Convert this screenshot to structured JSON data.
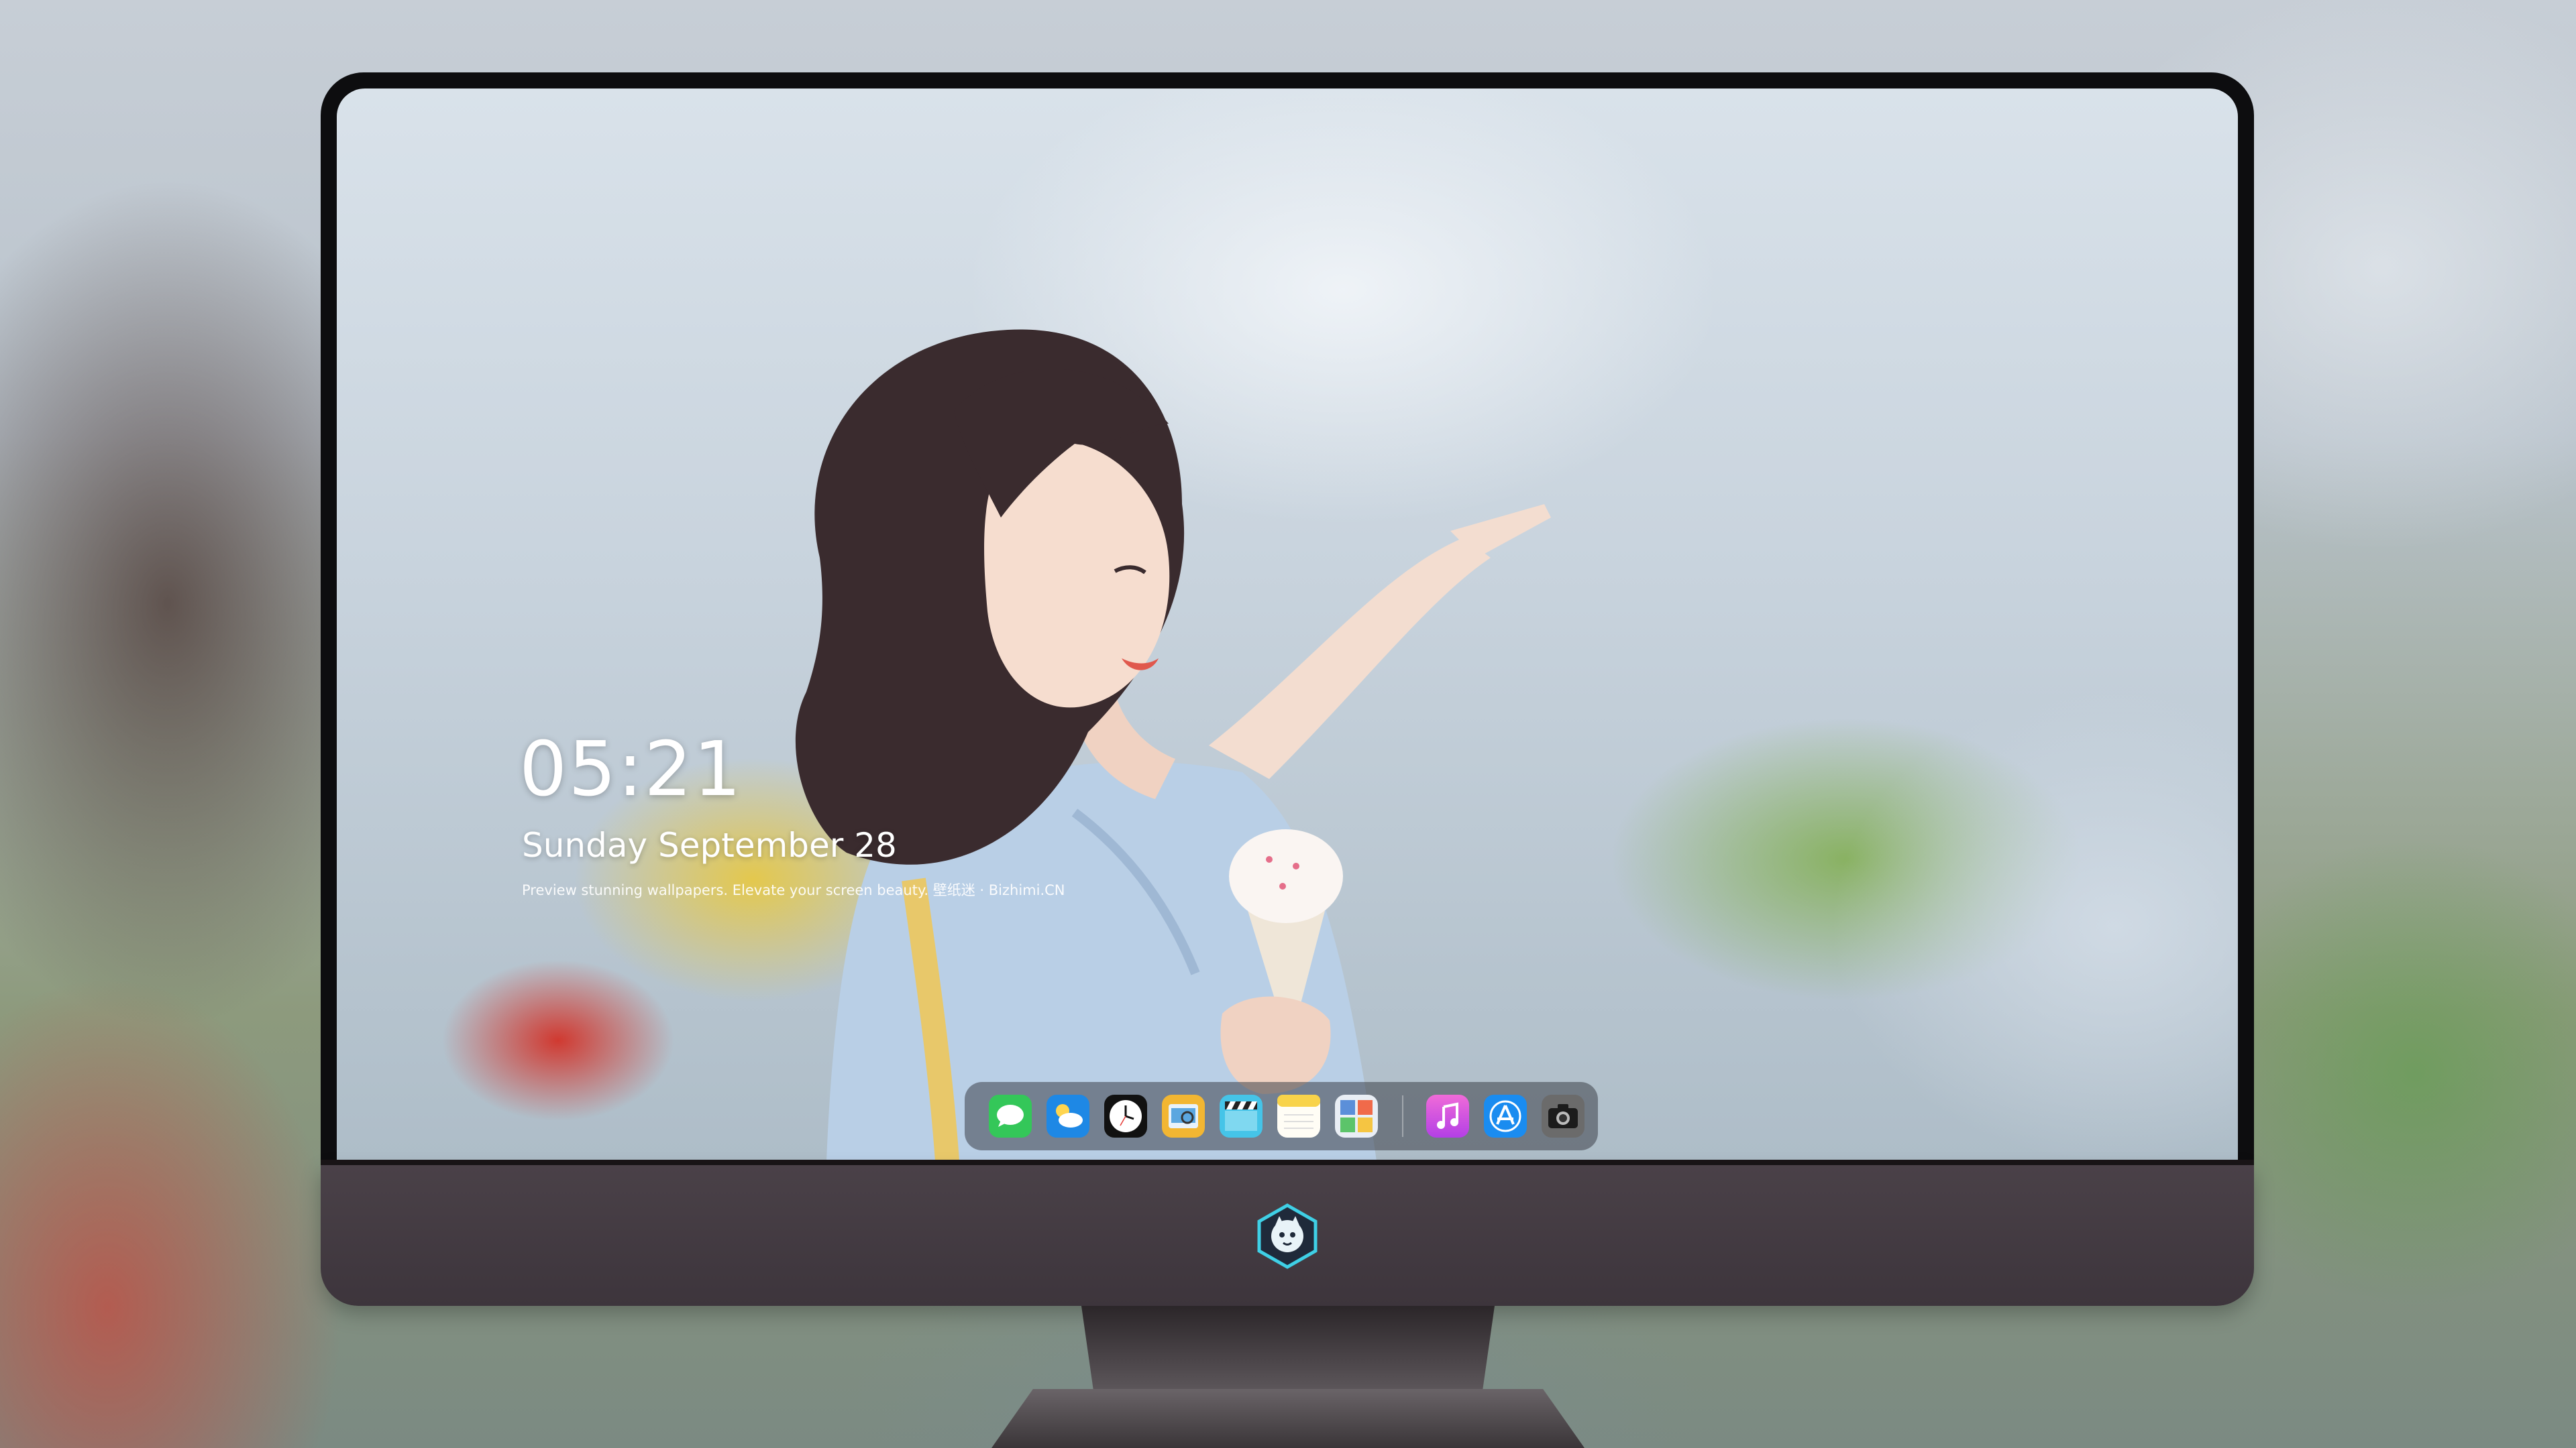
{
  "lock_screen": {
    "time": "05:21",
    "date": "Sunday September  28",
    "tagline": "Preview stunning wallpapers. Elevate your screen beauty. 壁纸迷 · Bizhimi.CN"
  },
  "dock": {
    "apps": [
      {
        "name": "Messages",
        "icon": "messages-icon",
        "color": "#34c759"
      },
      {
        "name": "Weather",
        "icon": "weather-icon",
        "color": "#1e88e5"
      },
      {
        "name": "Clock",
        "icon": "clock-icon",
        "color": "#111111"
      },
      {
        "name": "Preview",
        "icon": "preview-icon",
        "color": "#f2b632"
      },
      {
        "name": "Clips",
        "icon": "clapperboard-icon",
        "color": "#45c4e8"
      },
      {
        "name": "Notes",
        "icon": "notes-icon",
        "color": "#f8d34a"
      },
      {
        "name": "Photo Booth",
        "icon": "photo-gallery-icon",
        "color": "#5b8fd9"
      }
    ],
    "pinned": [
      {
        "name": "iTunes",
        "icon": "music-icon",
        "color": "#e04fd7"
      },
      {
        "name": "App Store",
        "icon": "app-store-icon",
        "color": "#1a8cf0"
      },
      {
        "name": "Camera",
        "icon": "camera-icon",
        "color": "#6b6b6b"
      }
    ]
  },
  "monitor": {
    "logo_icon": "brand-mascot-icon",
    "accent": "#3fd0e6"
  }
}
